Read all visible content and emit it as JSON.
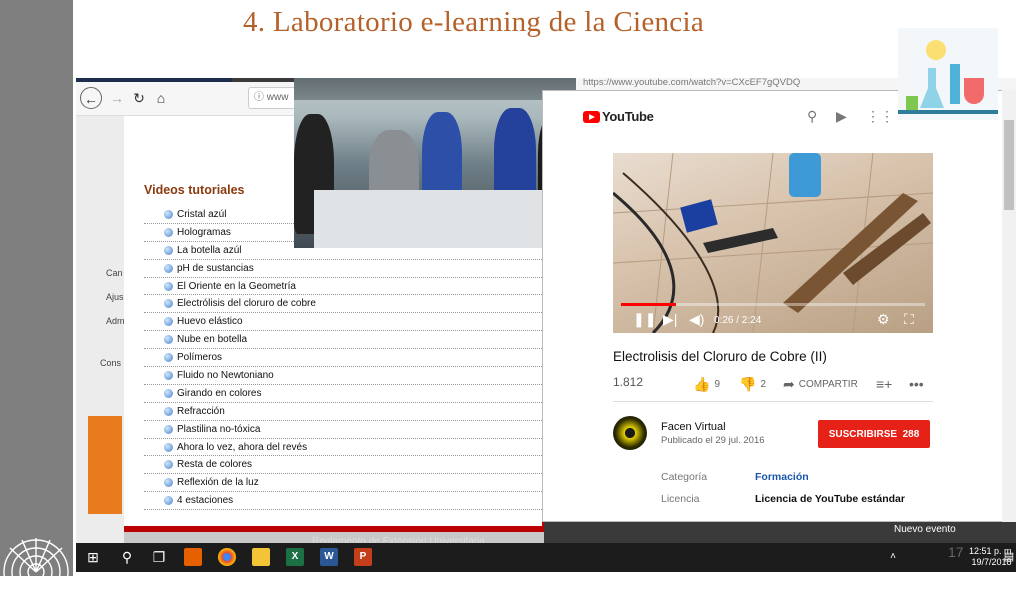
{
  "slide_title": "4. Laboratorio e-learning de la Ciencia",
  "page_number": "17",
  "left_browser": {
    "url_prefix": "www",
    "section_title": "Videos tutoriales",
    "videos": [
      "Cristal azúl",
      "Hologramas",
      "La botella azúl",
      "pH de sustancias",
      "El Oriente en la Geometría",
      "Electrólisis del cloruro de cobre",
      "Huevo elástico",
      "Nube en botella",
      "Polímeros",
      "Fluido no Newtoniano",
      "Girando en colores",
      "Refracción",
      "Plastilina no-tóxica",
      "Ahora lo vez, ahora del revés",
      "Resta de colores",
      "Reflexión de la luz",
      "4 estaciones"
    ],
    "side_items": [
      "Can",
      "Ajus",
      "Adm",
      "Cons"
    ],
    "footer_link": "Reglamento de Extensión Universitaria",
    "new_event": "Nuevo evento"
  },
  "youtube": {
    "url": "https://www.youtube.com/watch?v=CXcEF7gQVDQ",
    "logo_text": "YouTube",
    "video_time": "0:26 / 2:24",
    "progress": 0.18,
    "video_title": "Electrolisis del Cloruro de Cobre (II)",
    "views": "1.812",
    "likes": "9",
    "dislikes": "2",
    "share_label": "COMPARTIR",
    "channel_name": "Facen Virtual",
    "published": "Publicado el 29 jul. 2016",
    "subscribe_label": "SUSCRIBIRSE",
    "subscriber_count": "288",
    "category_label": "Categoría",
    "category_value": "Formación",
    "license_label": "Licencia",
    "license_value": "Licencia de YouTube estándar",
    "accent_color": "#e62117",
    "link_color": "#1a57a8"
  },
  "taskbar": {
    "time": "12:51 p. m.",
    "date": "19/7/2018"
  }
}
